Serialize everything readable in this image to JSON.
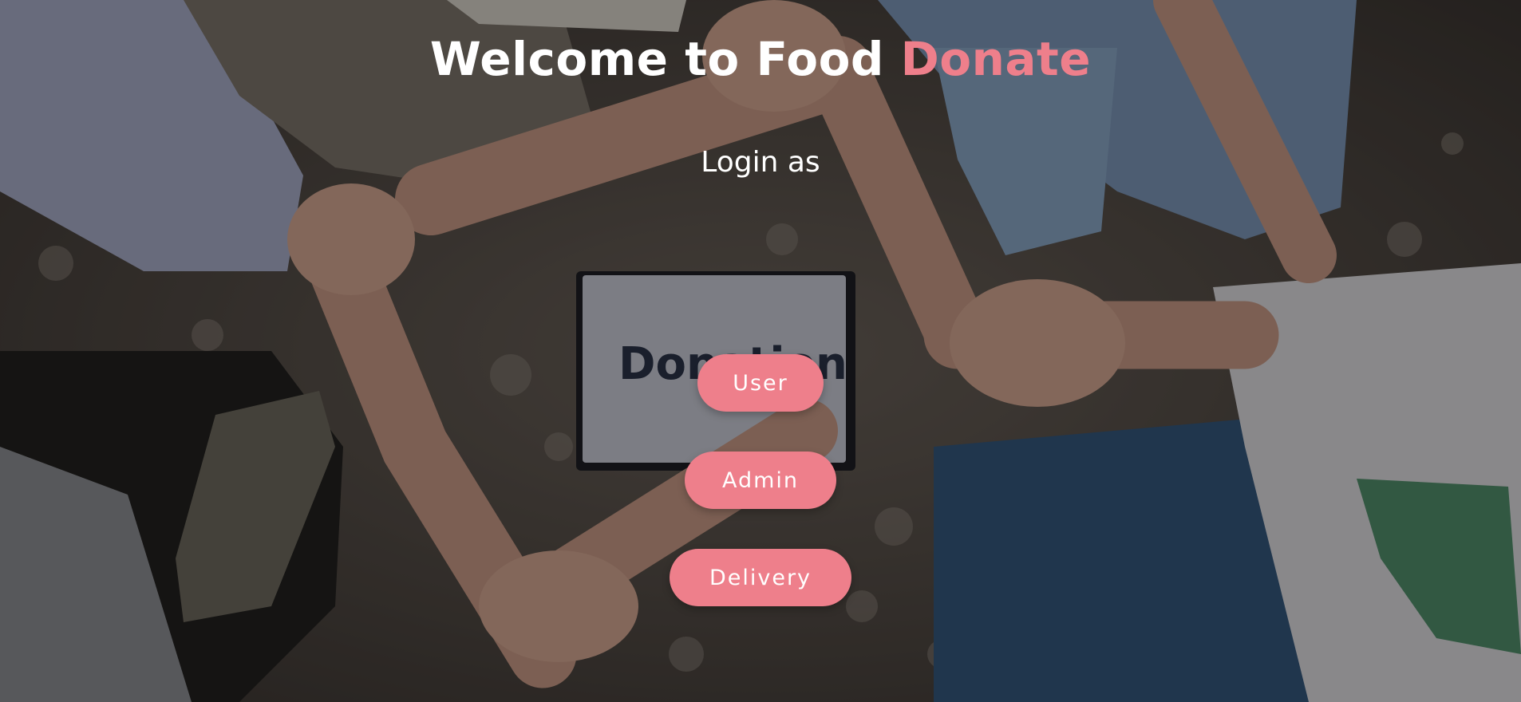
{
  "header": {
    "title_prefix": "Welcome to Food ",
    "title_accent": "Donate"
  },
  "login": {
    "heading": "Login as",
    "buttons": {
      "user": "User",
      "admin": "Admin",
      "delivery": "Delivery"
    }
  },
  "colors": {
    "accent": "#ee7f8b",
    "text": "#ffffff"
  },
  "background": {
    "image_subject": "hands-clasped-in-circle-photo"
  }
}
